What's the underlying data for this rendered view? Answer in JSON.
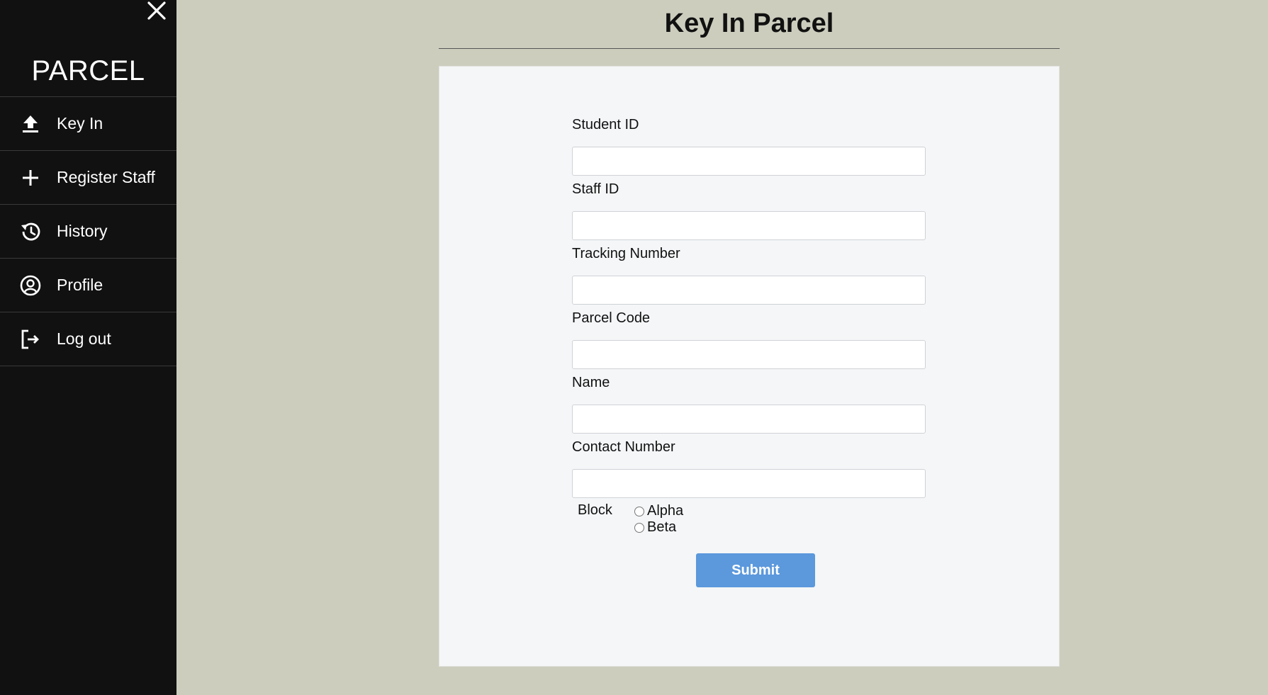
{
  "sidebar": {
    "brand": "PARCEL",
    "close_icon": "close-icon",
    "items": [
      {
        "label": "Key In",
        "icon": "upload-icon"
      },
      {
        "label": "Register Staff",
        "icon": "plus-icon"
      },
      {
        "label": "History",
        "icon": "history-icon"
      },
      {
        "label": "Profile",
        "icon": "user-circle-icon"
      },
      {
        "label": "Log out",
        "icon": "logout-icon"
      }
    ]
  },
  "main": {
    "title": "Key In Parcel",
    "form": {
      "fields": [
        {
          "label": "Student ID",
          "value": ""
        },
        {
          "label": "Staff ID",
          "value": ""
        },
        {
          "label": "Tracking Number",
          "value": ""
        },
        {
          "label": "Parcel Code",
          "value": ""
        },
        {
          "label": "Name",
          "value": ""
        },
        {
          "label": "Contact Number",
          "value": ""
        }
      ],
      "block": {
        "label": "Block",
        "options": [
          "Alpha",
          "Beta"
        ]
      },
      "submit_label": "Submit"
    }
  },
  "colors": {
    "sidebar_bg": "#111111",
    "page_bg": "#cccdbd",
    "card_bg": "#f4f6f8",
    "submit_bg": "#5b98dc"
  }
}
